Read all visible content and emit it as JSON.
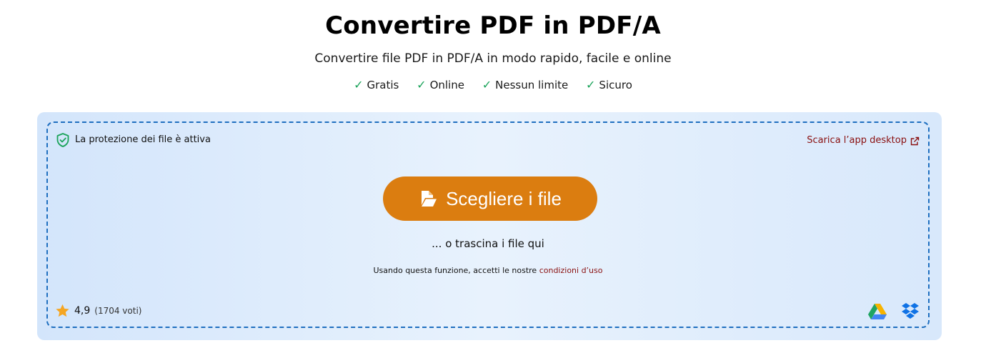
{
  "header": {
    "title": "Convertire PDF in PDF/A",
    "subtitle": "Convertire file PDF in PDF/A in modo rapido, facile e online",
    "features": [
      {
        "check": "✓",
        "label": "Gratis"
      },
      {
        "check": "✓",
        "label": "Online"
      },
      {
        "check": "✓",
        "label": "Nessun limite"
      },
      {
        "check": "✓",
        "label": "Sicuro"
      }
    ]
  },
  "upload": {
    "protection_text": "La protezione dei file è attiva",
    "desktop_link": "Scarica l’app desktop",
    "choose_button": "Scegliere i file",
    "drag_text": "... o trascina i file qui",
    "terms_prefix": "Usando questa funzione, accetti le nostre",
    "terms_link": "condizioni d’uso",
    "rating_value": "4,9",
    "rating_votes": "(1704 voti)"
  },
  "icons": {
    "protection": "shield-check-icon",
    "external": "external-link-icon",
    "file": "file-open-icon",
    "star": "star-icon",
    "google_drive": "google-drive-icon",
    "dropbox": "dropbox-icon"
  },
  "colors": {
    "accent_button": "#db7d10",
    "link": "#8a1010",
    "check": "#1aa35a",
    "dashed_border": "#1f6fc0",
    "star": "#f5a623"
  }
}
